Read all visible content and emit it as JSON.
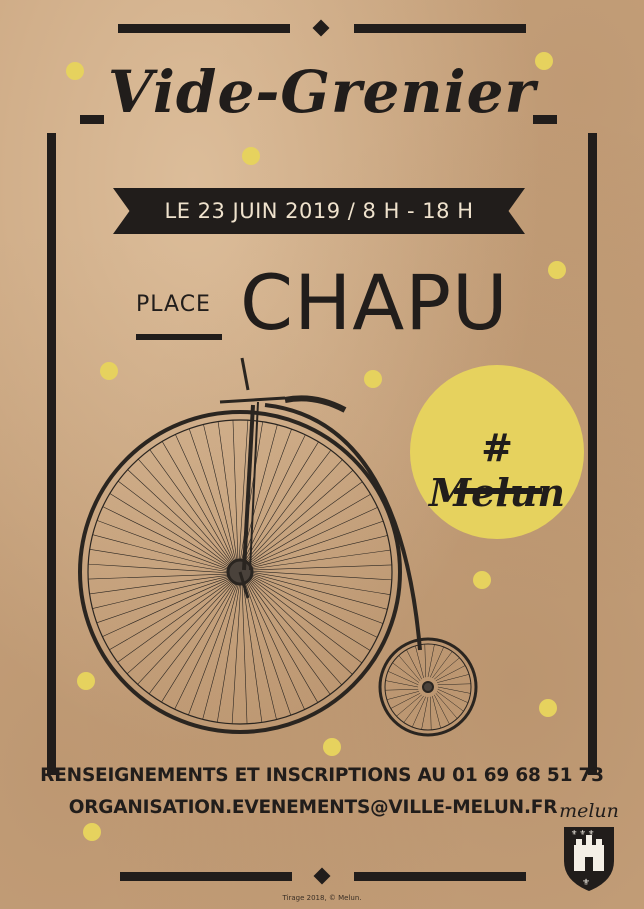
{
  "poster": {
    "title": "Vide-Grenier",
    "date_line": "LE 23 JUIN 2019 / 8 H - 18 H",
    "place_prefix": "PLACE",
    "place_name": "CHAPU",
    "hashtag": "# Melun",
    "info_line": "RENSEIGNEMENTS ET INSCRIPTIONS AU 01 69 68 51 73",
    "email_line": "ORGANISATION.EVENEMENTS@VILLE-MELUN.FR",
    "logo_text": "melun",
    "credit": "Tirage 2018, © Melun.",
    "illustration": "penny-farthing-bicycle"
  },
  "colors": {
    "paper": "#c9a47e",
    "ink": "#211d1b",
    "accent_yellow": "#e6d25e",
    "ribbon_text": "#efe2cd"
  }
}
